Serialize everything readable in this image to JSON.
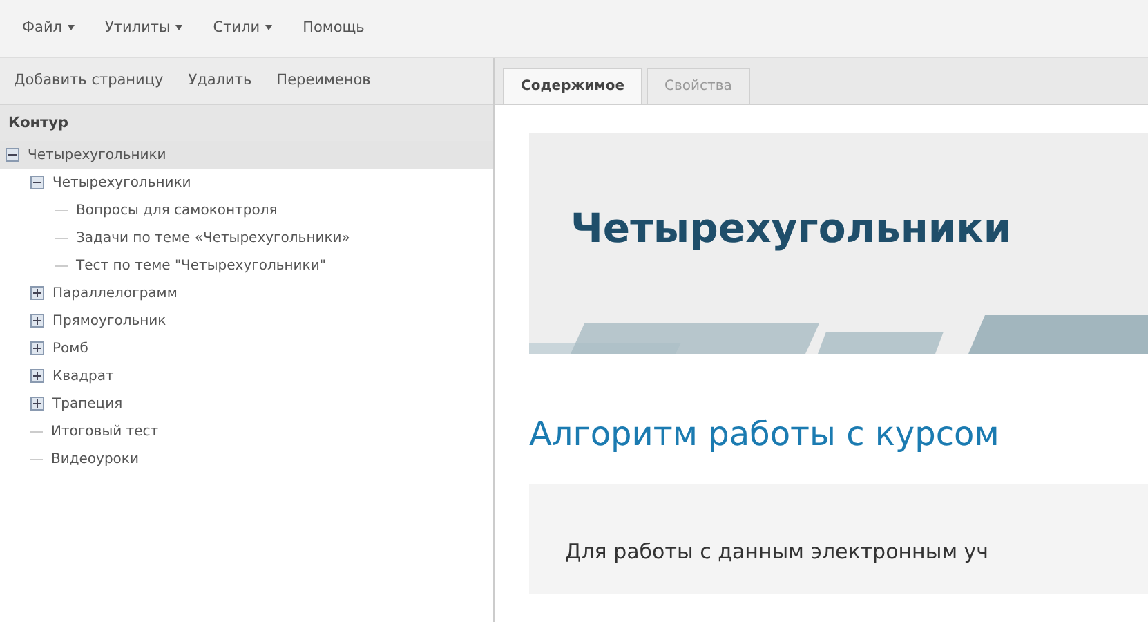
{
  "menu": [
    {
      "label": "Файл",
      "dropdown": true
    },
    {
      "label": "Утилиты",
      "dropdown": true
    },
    {
      "label": "Стили",
      "dropdown": true
    },
    {
      "label": "Помощь",
      "dropdown": false
    }
  ],
  "toolbar": [
    "Добавить страницу",
    "Удалить",
    "Переименов"
  ],
  "outline": {
    "title": "Контур",
    "tree": [
      {
        "label": "Четырехугольники",
        "selected": true,
        "expanded": true,
        "children": [
          {
            "label": "Четырехугольники",
            "selected": false,
            "expanded": true,
            "children": [
              {
                "label": "Вопросы для самоконтроля",
                "selected": false
              },
              {
                "label": "Задачи по теме «Четырехугольники»",
                "selected": false
              },
              {
                "label": "Тест по теме \"Четырехугольники\"",
                "selected": false
              }
            ]
          },
          {
            "label": "Параллелограмм",
            "selected": false,
            "expanded": false
          },
          {
            "label": "Прямоугольник",
            "selected": false,
            "expanded": false
          },
          {
            "label": "Ромб",
            "selected": false,
            "expanded": false
          },
          {
            "label": "Квадрат",
            "selected": false,
            "expanded": false
          },
          {
            "label": "Трапеция",
            "selected": false,
            "expanded": false
          },
          {
            "label": "Итоговый тест",
            "selected": false
          },
          {
            "label": "Видеоуроки",
            "selected": false
          }
        ]
      }
    ]
  },
  "tabs": [
    {
      "label": "Содержимое",
      "selected": true
    },
    {
      "label": "Свойства",
      "selected": false
    }
  ],
  "content": {
    "banner_title": "Четырехугольники",
    "heading": "Алгоритм работы с курсом",
    "box_text": "Для работы с данным электронным уч"
  }
}
